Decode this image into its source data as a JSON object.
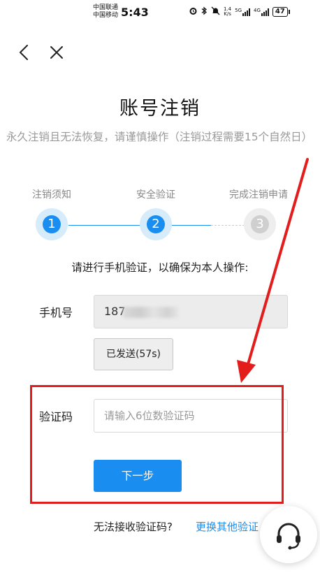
{
  "status_bar": {
    "carrier_1": "中国联通",
    "carrier_2": "中国移动",
    "time": "5:43",
    "net_speed_value": "1.4",
    "net_speed_unit": "K/s",
    "signal_1_tech": "5G",
    "signal_2_tech": "4G",
    "battery": "47"
  },
  "nav": {
    "back_icon": "chevron-left-icon",
    "close_icon": "close-icon"
  },
  "page": {
    "title": "账号注销",
    "subtitle": "永久注销且无法恢复，请谨慎操作（注销过程需要15个自然日）"
  },
  "steps": [
    {
      "label": "注销须知",
      "number": "1",
      "state": "done"
    },
    {
      "label": "安全验证",
      "number": "2",
      "state": "current"
    },
    {
      "label": "完成注销申请",
      "number": "3",
      "state": "pending"
    }
  ],
  "form": {
    "instruction": "请进行手机验证，以确保为本人操作:",
    "phone_label": "手机号",
    "phone_value": "187",
    "sent_button": "已发送(57s)",
    "code_label": "验证码",
    "code_placeholder": "请输入6位数验证码",
    "code_value": "",
    "next_button": "下一步"
  },
  "footer": {
    "question": "无法接收验证码?",
    "link": "更换其他验证"
  },
  "support_icon": "headset-icon",
  "colors": {
    "accent": "#1a8ef0",
    "annotation": "#e31c1c",
    "muted_text": "#9a9a9a"
  }
}
